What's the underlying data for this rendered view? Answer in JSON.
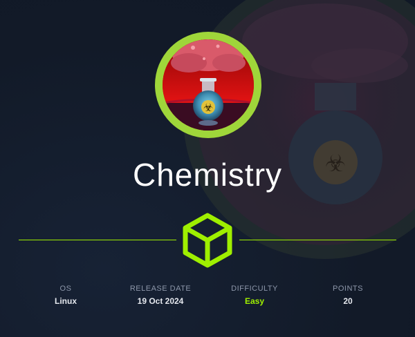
{
  "machine": {
    "name": "Chemistry"
  },
  "stats": {
    "os": {
      "label": "OS",
      "value": "Linux"
    },
    "release": {
      "label": "RELEASE DATE",
      "value": "19 Oct 2024"
    },
    "difficulty": {
      "label": "DIFFICULTY",
      "value": "Easy"
    },
    "points": {
      "label": "POINTS",
      "value": "20"
    }
  },
  "icons": {
    "avatar": "chemistry-flask-biohazard-icon",
    "difficulty_mark": "htb-cube-logo-icon"
  },
  "colors": {
    "background": "#141d2b",
    "accent": "#9fef00",
    "avatar_ring": "#9fd63a",
    "label": "#8d97aa",
    "value": "#e5e8ee"
  }
}
